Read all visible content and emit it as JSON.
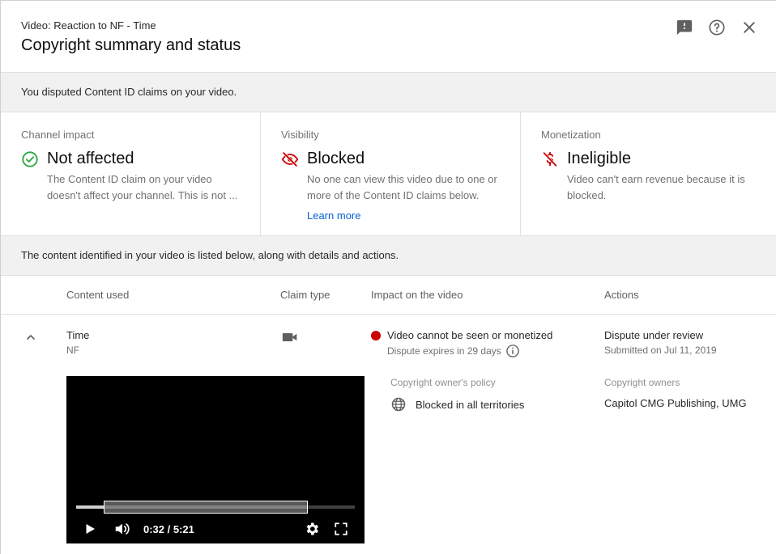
{
  "header": {
    "subtitle": "Video: Reaction to NF - Time",
    "title": "Copyright summary and status"
  },
  "banner": {
    "text": "You disputed Content ID claims on your video."
  },
  "cards": [
    {
      "label": "Channel impact",
      "value": "Not affected",
      "icon": "check-circle-icon",
      "icon_color": "#2ba640",
      "desc_line1": "The Content ID claim on your video",
      "desc_line2": "doesn't affect your channel. This is not ..."
    },
    {
      "label": "Visibility",
      "value": "Blocked",
      "icon": "eye-off-icon",
      "icon_color": "#cc0000",
      "desc_line1": "No one can view this video due to one or",
      "desc_line2": "more of the Content ID claims below.",
      "link": "Learn more"
    },
    {
      "label": "Monetization",
      "value": "Ineligible",
      "icon": "no-money-icon",
      "icon_color": "#cc0000",
      "desc_line1": "Video can't earn revenue because it is",
      "desc_line2": "blocked."
    }
  ],
  "banner2": {
    "text": "The content identified in your video is listed below, along with details and actions."
  },
  "table": {
    "headers": [
      "Content used",
      "Claim type",
      "Impact on the video",
      "Actions"
    ],
    "rows": [
      {
        "title": "Time",
        "artist": "NF",
        "claim_type_icon": "video-camera-icon",
        "impact": "Video cannot be seen or monetized",
        "dispute_expiry": "Dispute expires in 29 days",
        "action_status": "Dispute under review",
        "action_sub": "Submitted on Jul 11, 2019",
        "policy_label": "Copyright owner's policy",
        "policy": "Blocked in all territories",
        "owners_label": "Copyright owners",
        "owners": "Capitol CMG Publishing, UMG",
        "player": {
          "time": "0:32 / 5:21",
          "progress_fraction": 0.1,
          "segment_start_fraction": 0.1,
          "segment_end_fraction": 0.83
        }
      }
    ]
  },
  "colors": {
    "accent_link": "#065fd4",
    "ok_green": "#2ba640",
    "error_red": "#cc0000",
    "banner_bg": "#f1f1f1"
  }
}
